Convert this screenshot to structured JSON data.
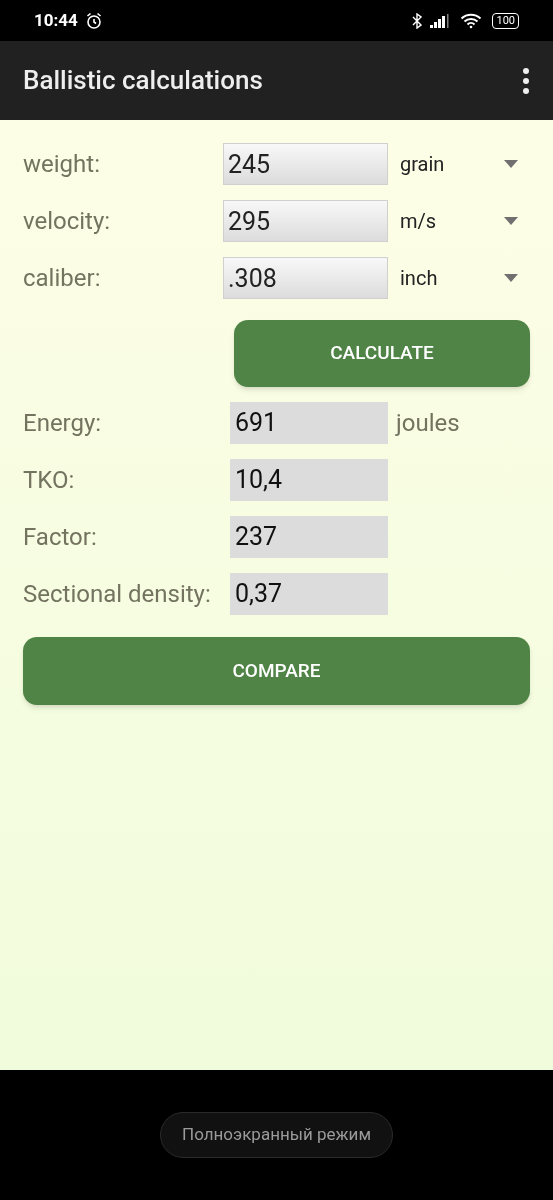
{
  "status_bar": {
    "time": "10:44",
    "battery": "100"
  },
  "app_bar": {
    "title": "Ballistic calculations"
  },
  "inputs": [
    {
      "label": "weight:",
      "value": "245",
      "unit": "grain"
    },
    {
      "label": "velocity:",
      "value": "295",
      "unit": "m/s"
    },
    {
      "label": "caliber:",
      "value": ".308",
      "unit": "inch"
    }
  ],
  "calculate_button": "CALCULATE",
  "results": [
    {
      "label": "Energy:",
      "value": "691",
      "unit": "joules"
    },
    {
      "label": "TKO:",
      "value": "10,4"
    },
    {
      "label": "Factor:",
      "value": "237"
    },
    {
      "label": "Sectional density:",
      "value": "0,37"
    }
  ],
  "compare_button": "COMPARE",
  "fullscreen_toast": "Полноэкранный режим"
}
